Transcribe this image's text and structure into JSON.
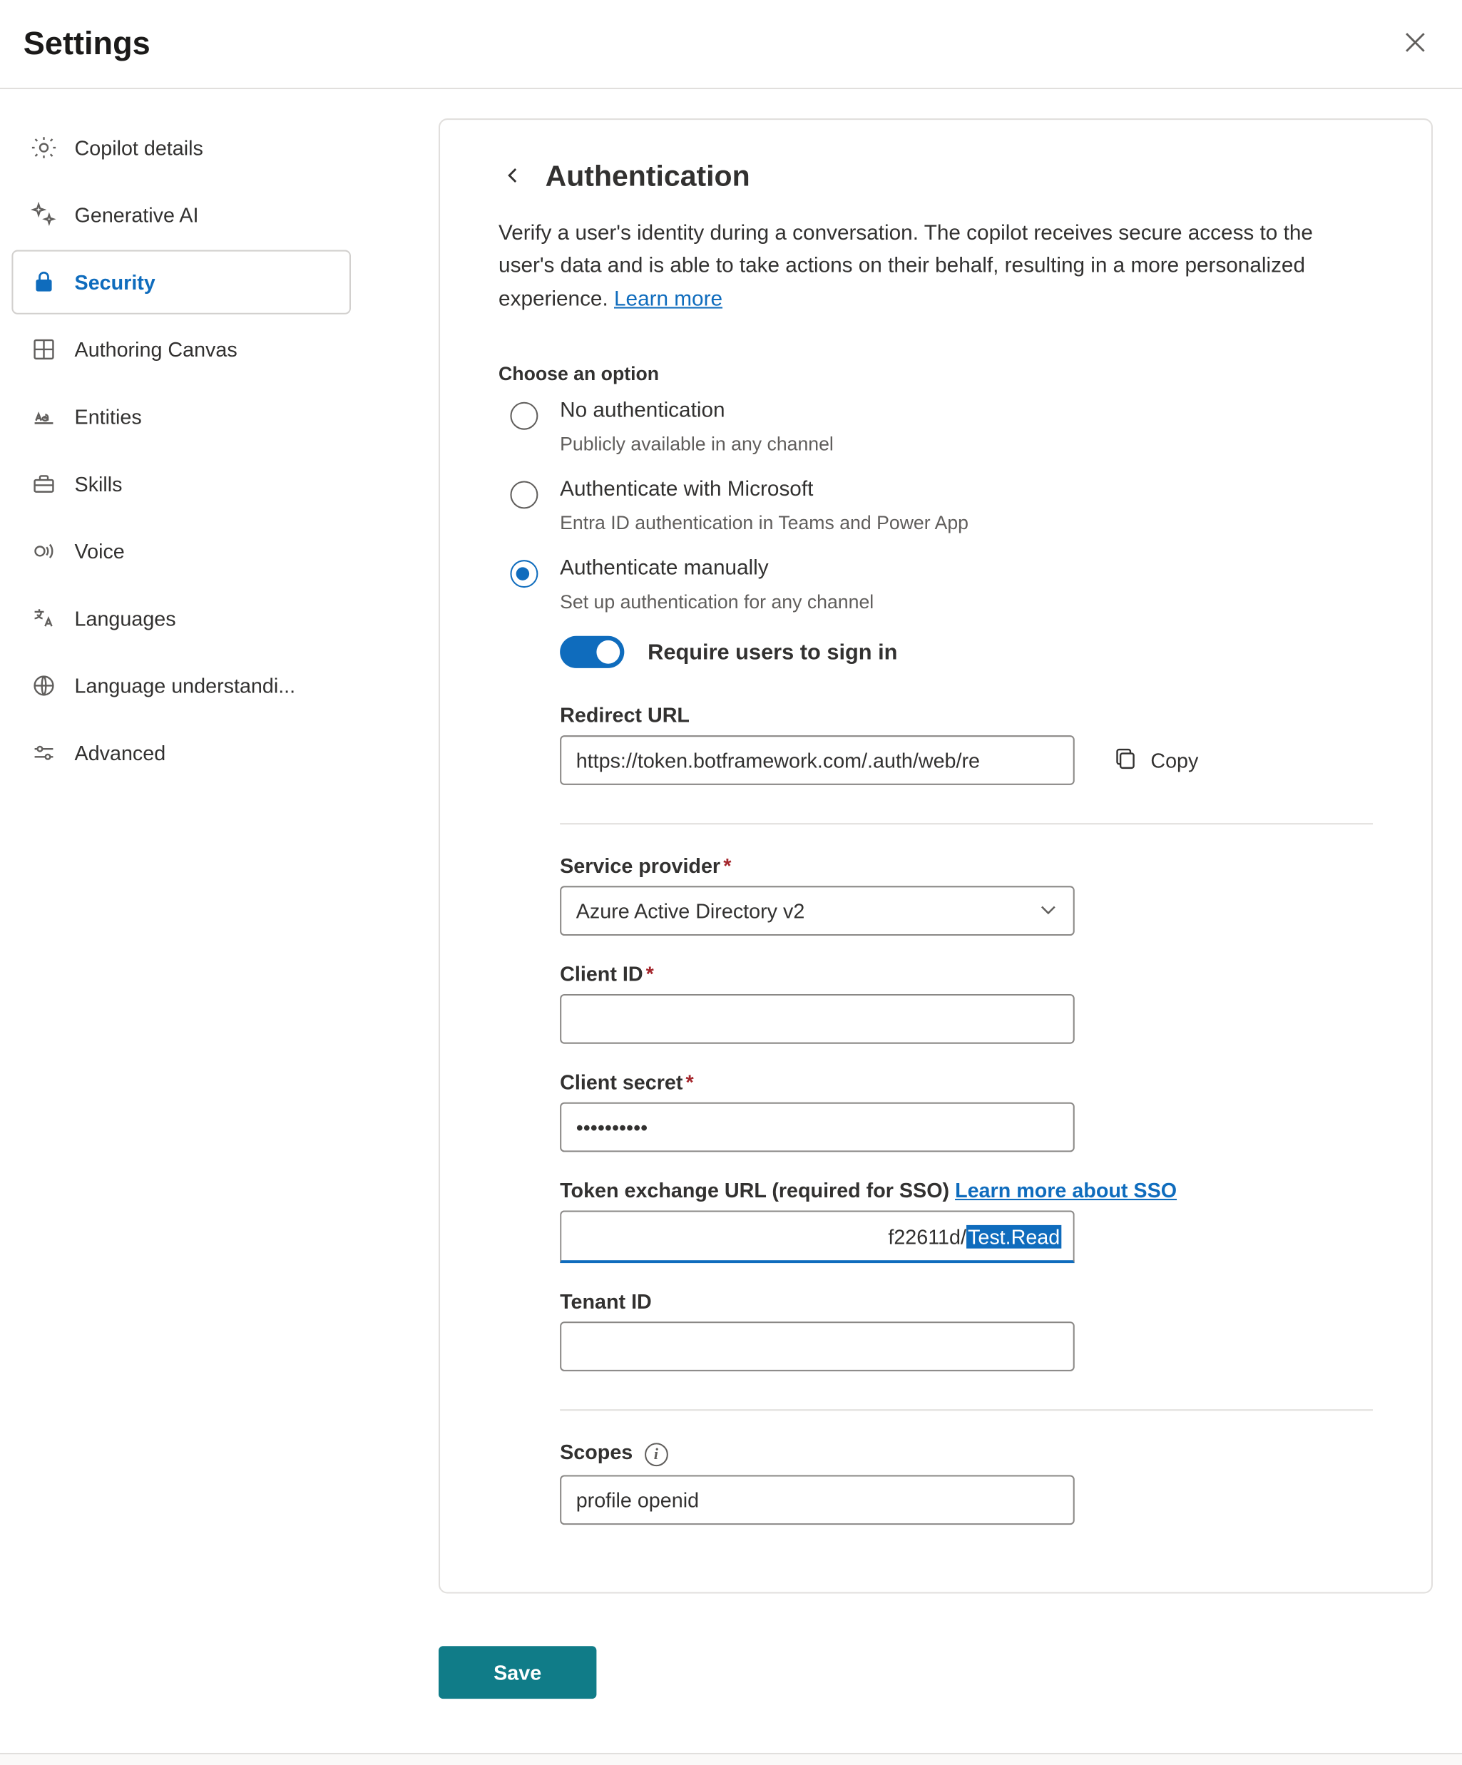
{
  "header": {
    "title": "Settings"
  },
  "sidebar": {
    "items": [
      {
        "label": "Copilot details",
        "icon": "gear-icon",
        "active": false
      },
      {
        "label": "Generative AI",
        "icon": "sparkle-icon",
        "active": false
      },
      {
        "label": "Security",
        "icon": "lock-icon",
        "active": true
      },
      {
        "label": "Authoring Canvas",
        "icon": "grid-icon",
        "active": false
      },
      {
        "label": "Entities",
        "icon": "text-icon",
        "active": false
      },
      {
        "label": "Skills",
        "icon": "briefcase-icon",
        "active": false
      },
      {
        "label": "Voice",
        "icon": "voice-icon",
        "active": false
      },
      {
        "label": "Languages",
        "icon": "translate-icon",
        "active": false
      },
      {
        "label": "Language understandi...",
        "icon": "globe-icon",
        "active": false
      },
      {
        "label": "Advanced",
        "icon": "sliders-icon",
        "active": false
      }
    ]
  },
  "page": {
    "title": "Authentication",
    "description": "Verify a user's identity during a conversation. The copilot receives secure access to the user's data and is able to take actions on their behalf, resulting in a more personalized experience. ",
    "learn_more": "Learn more",
    "choose_label": "Choose an option",
    "options": [
      {
        "title": "No authentication",
        "sub": "Publicly available in any channel",
        "selected": false
      },
      {
        "title": "Authenticate with Microsoft",
        "sub": "Entra ID authentication in Teams and Power App",
        "selected": false
      },
      {
        "title": "Authenticate manually",
        "sub": "Set up authentication for any channel",
        "selected": true
      }
    ],
    "require_signin": {
      "label": "Require users to sign in",
      "on": true
    },
    "redirect": {
      "label": "Redirect URL",
      "value": "https://token.botframework.com/.auth/web/re",
      "copy_label": "Copy"
    },
    "provider": {
      "label": "Service provider",
      "value": "Azure Active Directory v2"
    },
    "client_id": {
      "label": "Client ID",
      "value": ""
    },
    "client_secret": {
      "label": "Client secret",
      "value": "••••••••••"
    },
    "token_exchange": {
      "label": "Token exchange URL (required for SSO) ",
      "link": "Learn more about SSO",
      "value_plain": "f22611d/",
      "value_selected": "Test.Read"
    },
    "tenant_id": {
      "label": "Tenant ID",
      "value": ""
    },
    "scopes": {
      "label": "Scopes",
      "value": "profile openid"
    }
  },
  "footer": {
    "save": "Save"
  }
}
